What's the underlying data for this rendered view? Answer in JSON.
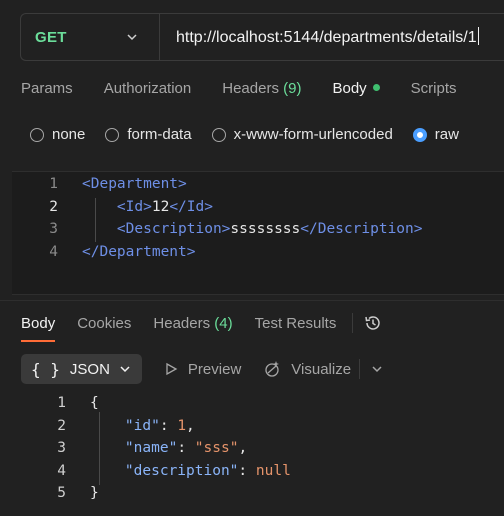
{
  "request": {
    "method": "GET",
    "url": "http://localhost:5144/departments/details/1"
  },
  "request_tabs": [
    {
      "label": "Params",
      "count": ""
    },
    {
      "label": "Authorization",
      "count": ""
    },
    {
      "label": "Headers",
      "count": "(9)"
    },
    {
      "label": "Body",
      "count": ""
    },
    {
      "label": "Scripts",
      "count": ""
    }
  ],
  "body_types": [
    "none",
    "form-data",
    "x-www-form-urlencoded",
    "raw"
  ],
  "selected_body_type": "raw",
  "editor": {
    "line_numbers": [
      "1",
      "2",
      "3",
      "4"
    ],
    "lines": [
      [
        {
          "t": "tag",
          "v": "<Department>"
        }
      ],
      [
        {
          "t": "indent",
          "v": "    "
        },
        {
          "t": "tag",
          "v": "<Id>"
        },
        {
          "t": "text",
          "v": "12"
        },
        {
          "t": "tag",
          "v": "</Id>"
        }
      ],
      [
        {
          "t": "indent",
          "v": "    "
        },
        {
          "t": "tag",
          "v": "<Description>"
        },
        {
          "t": "text",
          "v": "ssssssss"
        },
        {
          "t": "tag",
          "v": "</Description>"
        }
      ],
      [
        {
          "t": "tag",
          "v": "</Department>"
        }
      ]
    ]
  },
  "response_tabs": [
    {
      "label": "Body",
      "count": ""
    },
    {
      "label": "Cookies",
      "count": ""
    },
    {
      "label": "Headers",
      "count": "(4)"
    },
    {
      "label": "Test Results",
      "count": ""
    }
  ],
  "response_toolbar": {
    "format_braces": "{ }",
    "format_label": "JSON",
    "preview_label": "Preview",
    "visualize_label": "Visualize"
  },
  "response": {
    "line_numbers": [
      "1",
      "2",
      "3",
      "4",
      "5"
    ],
    "lines": [
      [
        {
          "t": "punct",
          "v": "{"
        }
      ],
      [
        {
          "t": "indent",
          "v": "    "
        },
        {
          "t": "key",
          "v": "\"id\""
        },
        {
          "t": "punct",
          "v": ": "
        },
        {
          "t": "num",
          "v": "1"
        },
        {
          "t": "punct",
          "v": ","
        }
      ],
      [
        {
          "t": "indent",
          "v": "    "
        },
        {
          "t": "key",
          "v": "\"name\""
        },
        {
          "t": "punct",
          "v": ": "
        },
        {
          "t": "str",
          "v": "\"sss\""
        },
        {
          "t": "punct",
          "v": ","
        }
      ],
      [
        {
          "t": "indent",
          "v": "    "
        },
        {
          "t": "key",
          "v": "\"description\""
        },
        {
          "t": "punct",
          "v": ": "
        },
        {
          "t": "null",
          "v": "null"
        }
      ],
      [
        {
          "t": "punct",
          "v": "}"
        }
      ]
    ]
  },
  "colors": {
    "accent": "#ff6c37",
    "method_get": "#6bdd9a",
    "radio_selected": "#4a9eff",
    "xml_tag": "#6e8fe6",
    "json_key": "#8ab4f8",
    "json_value": "#e6946b"
  }
}
